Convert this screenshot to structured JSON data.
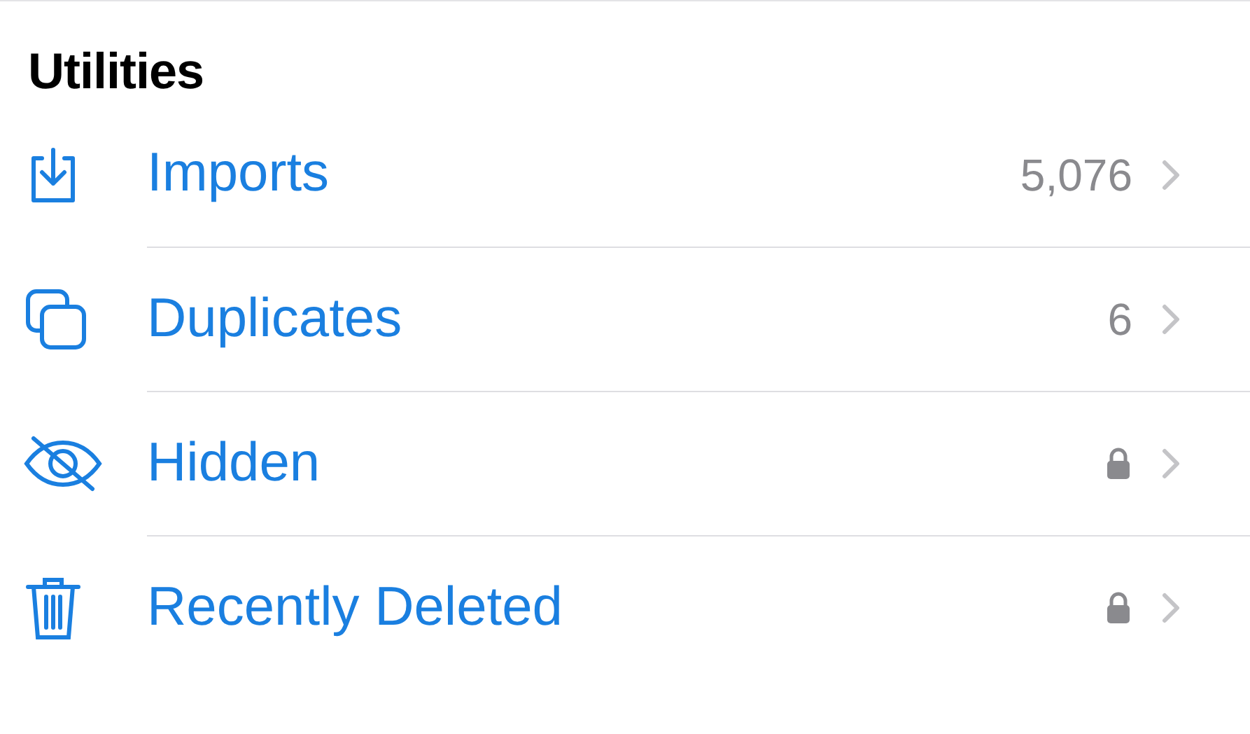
{
  "section": {
    "title": "Utilities"
  },
  "items": [
    {
      "kind": "import",
      "label": "Imports",
      "count": "5,076",
      "locked": false
    },
    {
      "kind": "duplicate",
      "label": "Duplicates",
      "count": "6",
      "locked": false
    },
    {
      "kind": "hidden",
      "label": "Hidden",
      "locked": true
    },
    {
      "kind": "trash",
      "label": "Recently Deleted",
      "locked": true
    }
  ]
}
